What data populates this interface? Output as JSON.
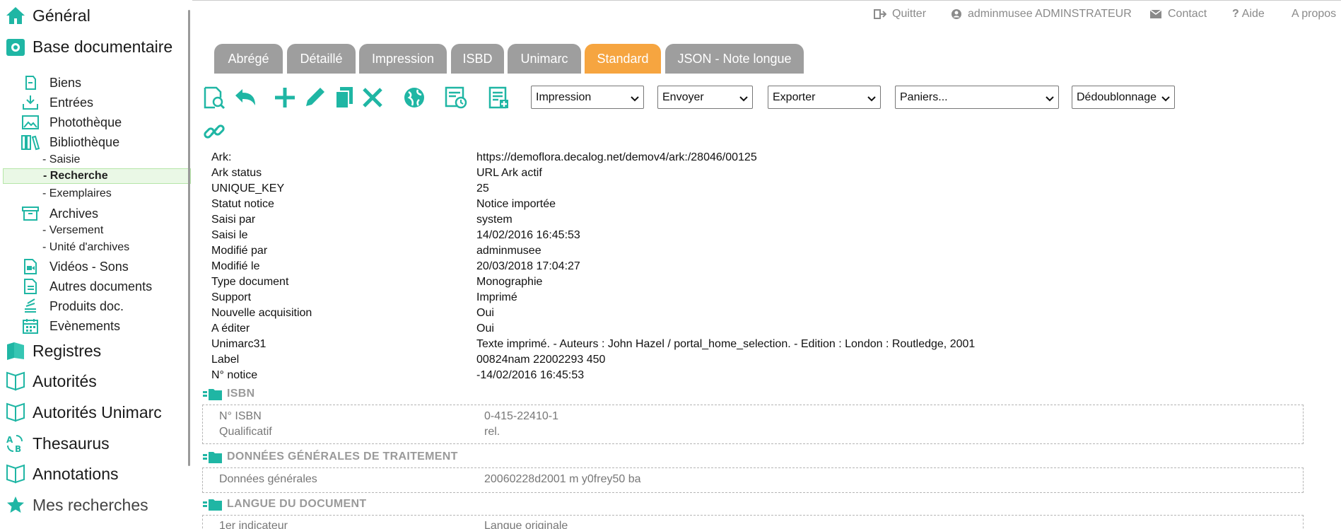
{
  "sidebar": {
    "main": [
      {
        "label": "Général",
        "icon": "home-icon"
      },
      {
        "label": "Base documentaire",
        "icon": "database-icon"
      },
      {
        "label": "Registres",
        "icon": "registers-icon"
      },
      {
        "label": "Autorités",
        "icon": "book-icon"
      },
      {
        "label": "Autorités Unimarc",
        "icon": "book-icon"
      },
      {
        "label": "Thesaurus",
        "icon": "thesaurus-icon"
      },
      {
        "label": "Annotations",
        "icon": "book-icon"
      },
      {
        "label": "Mes recherches",
        "icon": "star-icon"
      }
    ],
    "sub": [
      {
        "label": "Biens",
        "icon": "hand-icon"
      },
      {
        "label": "Entrées",
        "icon": "inbox-icon"
      },
      {
        "label": "Photothèque",
        "icon": "image-icon"
      },
      {
        "label": "Bibliothèque",
        "icon": "library-icon"
      },
      {
        "label": "Archives",
        "icon": "archive-icon"
      },
      {
        "label": "Vidéos - Sons",
        "icon": "video-icon"
      },
      {
        "label": "Autres documents",
        "icon": "document-icon"
      },
      {
        "label": "Produits doc.",
        "icon": "stack-icon"
      },
      {
        "label": "Evènements",
        "icon": "calendar-icon"
      }
    ],
    "bibliotheque_children": [
      "- Saisie",
      "- Recherche",
      "- Exemplaires"
    ],
    "archives_children": [
      "- Versement",
      "- Unité d'archives"
    ]
  },
  "topbar": {
    "quit": "Quitter",
    "user": "adminmusee ADMINSTRATEUR",
    "contact": "Contact",
    "help": "Aide",
    "about": "A propos"
  },
  "tabs": [
    "Abrégé",
    "Détaillé",
    "Impression",
    "ISBD",
    "Unimarc",
    "Standard",
    "JSON - Note longue"
  ],
  "active_tab": "Standard",
  "toolbar": {
    "selects": [
      "Impression",
      "Envoyer",
      "Exporter",
      "Paniers...",
      "Dédoublonnage"
    ]
  },
  "record": [
    {
      "k": "Ark:",
      "v": "https://demoflora.decalog.net/demov4/ark:/28046/00125"
    },
    {
      "k": "Ark status",
      "v": "URL Ark actif"
    },
    {
      "k": "UNIQUE_KEY",
      "v": "25"
    },
    {
      "k": "Statut notice",
      "v": "Notice importée"
    },
    {
      "k": "Saisi par",
      "v": "system"
    },
    {
      "k": "Saisi le",
      "v": "14/02/2016 16:45:53"
    },
    {
      "k": "Modifié par",
      "v": "adminmusee"
    },
    {
      "k": "Modifié le",
      "v": "20/03/2018 17:04:27"
    },
    {
      "k": "Type document",
      "v": "Monographie"
    },
    {
      "k": "Support",
      "v": "Imprimé"
    },
    {
      "k": "Nouvelle acquisition",
      "v": "Oui"
    },
    {
      "k": "A éditer",
      "v": "Oui"
    },
    {
      "k": "Unimarc31",
      "v": "Texte imprimé. - Auteurs : John Hazel / portal_home_selection. - Edition : London : Routledge, 2001"
    },
    {
      "k": "Label",
      "v": "00824nam 22002293 450"
    },
    {
      "k": "N° notice",
      "v": "-14/02/2016 16:45:53"
    }
  ],
  "sections": [
    {
      "title": "ISBN",
      "rows": [
        {
          "k": "N° ISBN",
          "v": "0-415-22410-1"
        },
        {
          "k": "Qualificatif",
          "v": "rel."
        }
      ]
    },
    {
      "title": "DONNÉES GÉNÉRALES DE TRAITEMENT",
      "rows": [
        {
          "k": "Données générales",
          "v": "20060228d2001 m y0frey50 ba"
        }
      ]
    },
    {
      "title": "LANGUE DU DOCUMENT",
      "rows": [
        {
          "k": "1er indicateur",
          "v": "Langue originale"
        }
      ]
    }
  ],
  "colors": {
    "accent": "#1fb6a4",
    "tab_active": "#f6a540",
    "tab": "#9e9e9e",
    "active_bg": "#eaf8e6"
  }
}
